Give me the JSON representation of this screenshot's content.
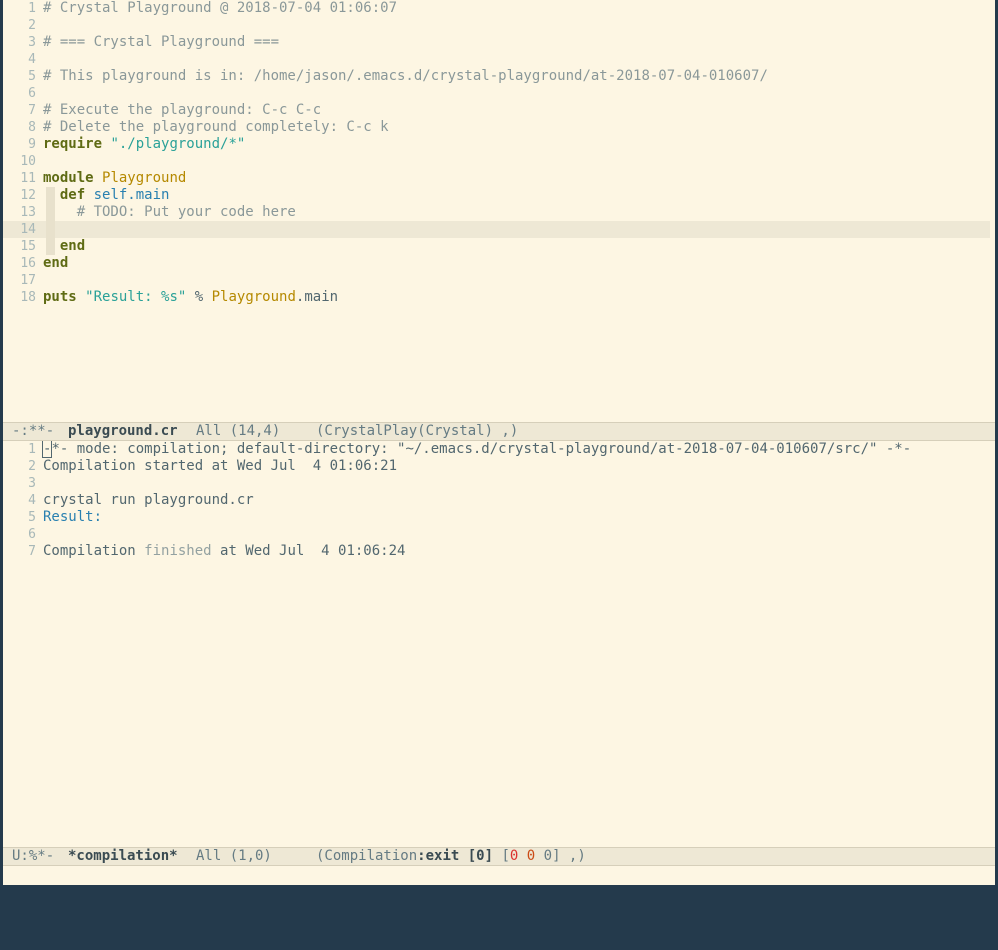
{
  "editor": {
    "lines": [
      {
        "n": "1",
        "parts": [
          {
            "t": "# Crystal Playground @ 2018-07-04 01:06:07",
            "c": "com"
          }
        ]
      },
      {
        "n": "2",
        "parts": []
      },
      {
        "n": "3",
        "parts": [
          {
            "t": "# === Crystal Playground ===",
            "c": "com"
          }
        ]
      },
      {
        "n": "4",
        "parts": []
      },
      {
        "n": "5",
        "parts": [
          {
            "t": "# This playground is in: /home/jason/.emacs.d/crystal-playground/at-2018-07-04-010607/",
            "c": "com"
          }
        ]
      },
      {
        "n": "6",
        "parts": []
      },
      {
        "n": "7",
        "parts": [
          {
            "t": "# Execute the playground: C-c C-c",
            "c": "com"
          }
        ]
      },
      {
        "n": "8",
        "parts": [
          {
            "t": "# Delete the playground completely: C-c k",
            "c": "com"
          }
        ]
      },
      {
        "n": "9",
        "parts": [
          {
            "t": "require",
            "c": "kw"
          },
          {
            "t": " ",
            "c": ""
          },
          {
            "t": "\"./playground/*\"",
            "c": "str"
          }
        ]
      },
      {
        "n": "10",
        "parts": []
      },
      {
        "n": "11",
        "parts": [
          {
            "t": "module",
            "c": "kw"
          },
          {
            "t": " ",
            "c": ""
          },
          {
            "t": "Playground",
            "c": "typ"
          }
        ]
      },
      {
        "n": "12",
        "guide": true,
        "parts": [
          {
            "t": "  ",
            "c": ""
          },
          {
            "t": "def",
            "c": "kw"
          },
          {
            "t": " ",
            "c": ""
          },
          {
            "t": "self.main",
            "c": "fn"
          }
        ]
      },
      {
        "n": "13",
        "guide": true,
        "parts": [
          {
            "t": "    # TODO: Put your code here",
            "c": "com"
          }
        ]
      },
      {
        "n": "14",
        "guide": true,
        "hl": true,
        "parts": []
      },
      {
        "n": "15",
        "guide": true,
        "parts": [
          {
            "t": "  ",
            "c": ""
          },
          {
            "t": "end",
            "c": "kw"
          }
        ]
      },
      {
        "n": "16",
        "parts": [
          {
            "t": "end",
            "c": "kw"
          }
        ]
      },
      {
        "n": "17",
        "parts": []
      },
      {
        "n": "18",
        "parts": [
          {
            "t": "puts",
            "c": "kw"
          },
          {
            "t": " ",
            "c": ""
          },
          {
            "t": "\"Result: %s\"",
            "c": "str"
          },
          {
            "t": " % ",
            "c": ""
          },
          {
            "t": "Playground",
            "c": "typ"
          },
          {
            "t": ".main",
            "c": ""
          }
        ]
      }
    ]
  },
  "modeline_top": {
    "state": "-:**-",
    "buffer": "playground.cr",
    "position": "All (14,4)",
    "mode": "(CrystalPlay(Crystal) ,)"
  },
  "compilation": {
    "lines": [
      {
        "n": "1",
        "parts": [
          {
            "t": "-",
            "c": "cursor"
          },
          {
            "t": "*- mode: compilation; default-directory: \"~/.emacs.d/crystal-playground/at-2018-07-04-010607/src/\" -*-",
            "c": ""
          }
        ]
      },
      {
        "n": "2",
        "parts": [
          {
            "t": "Compilation started at Wed Jul  4 01:06:21",
            "c": ""
          }
        ]
      },
      {
        "n": "3",
        "parts": []
      },
      {
        "n": "4",
        "parts": [
          {
            "t": "crystal run playground.cr",
            "c": ""
          }
        ]
      },
      {
        "n": "5",
        "parts": [
          {
            "t": "Result:",
            "c": "fn"
          }
        ]
      },
      {
        "n": "6",
        "parts": []
      },
      {
        "n": "7",
        "parts": [
          {
            "t": "Compilation ",
            "c": ""
          },
          {
            "t": "finished",
            "c": "dim"
          },
          {
            "t": " at Wed Jul  4 01:06:24",
            "c": ""
          }
        ]
      }
    ]
  },
  "modeline_bottom": {
    "state": "U:%*-",
    "buffer": "*compilation*",
    "position": "All (1,0)",
    "mode_prefix": "(Compilation",
    "mode_exit": ":exit [0]",
    "bracket_open": " [",
    "count_errors": "0",
    "count_warnings": "0",
    "count_infos": "0",
    "mode_suffix": "] ,)"
  },
  "colors": {
    "background": "#fdf6e3",
    "modeline": "#eee8d5",
    "frame": "#243a4c"
  }
}
